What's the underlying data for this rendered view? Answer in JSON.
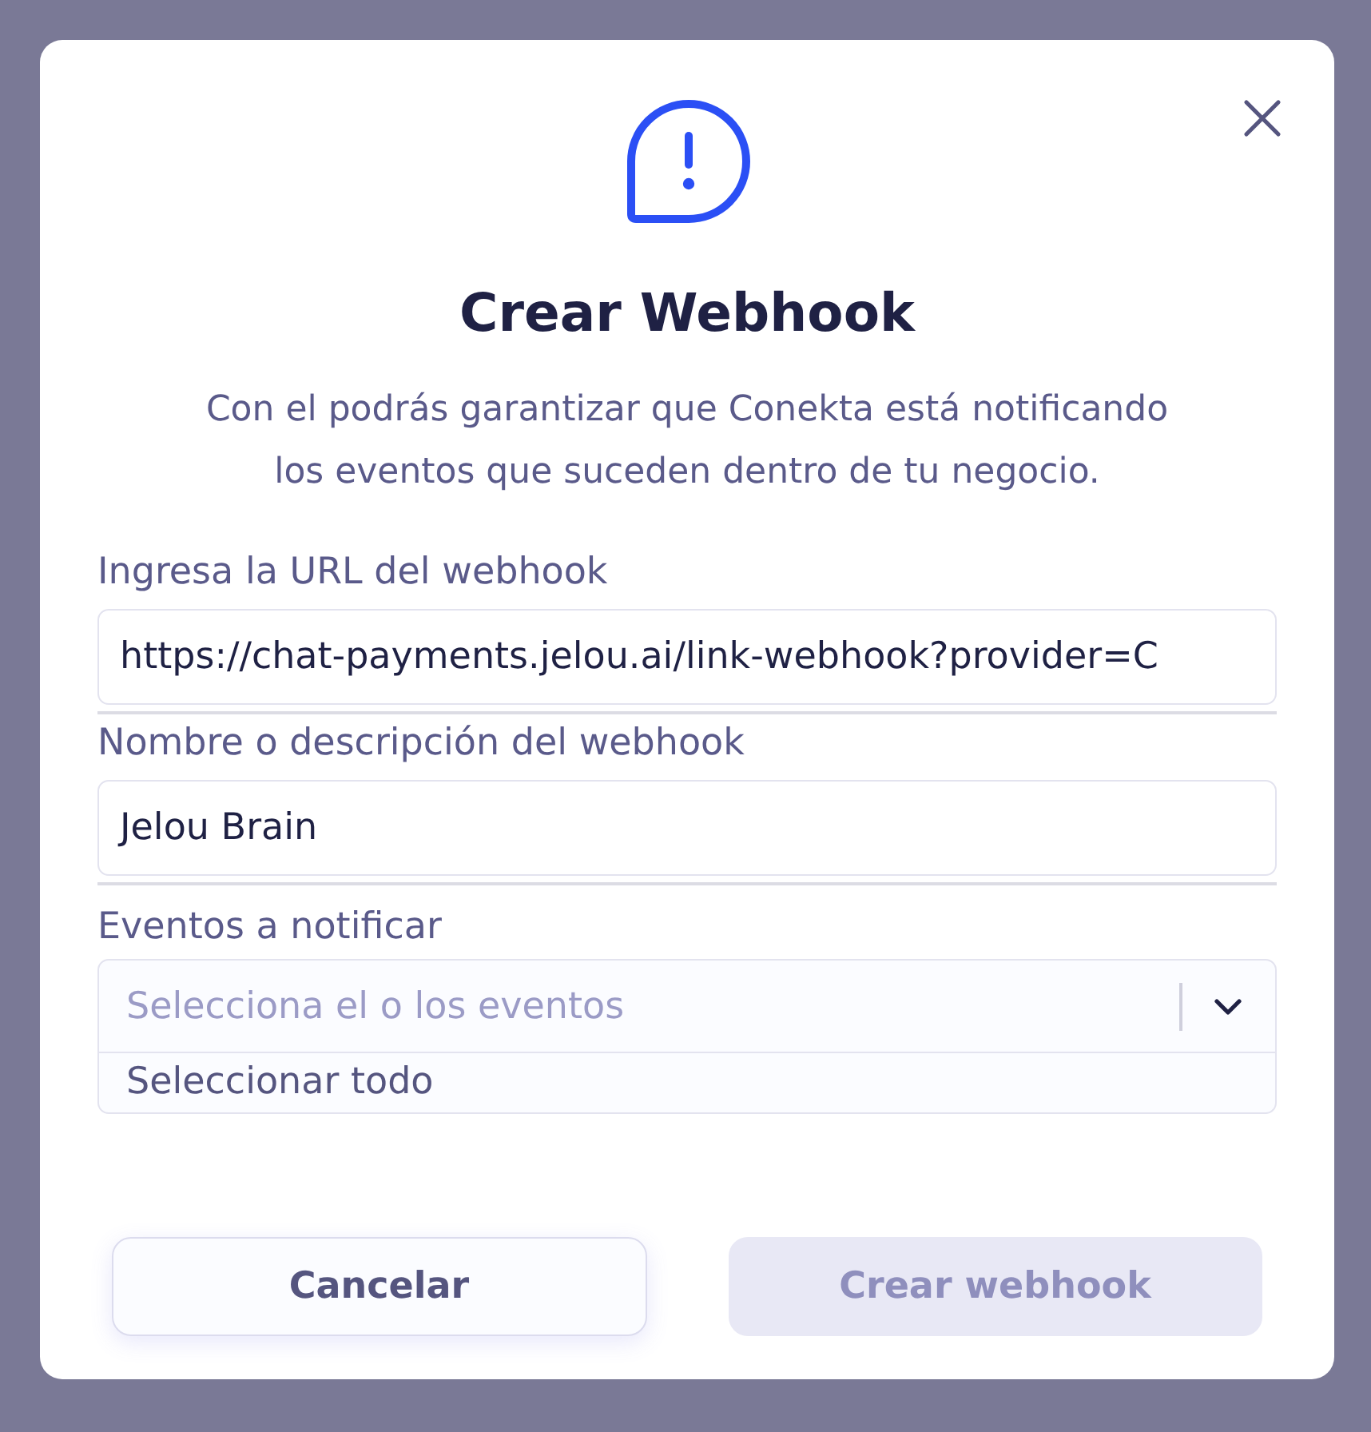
{
  "dialog": {
    "title": "Crear Webhook",
    "description": "Con el podrás garantizar que Conekta está notificando los eventos que suceden dentro de tu negocio."
  },
  "fields": [
    {
      "kind": "text",
      "label": "Ingresa la URL del webhook",
      "value": "https://chat-payments.jelou.ai/link-webhook?provider=C"
    },
    {
      "kind": "text",
      "label": "Nombre o descripción del webhook",
      "value": "Jelou Brain"
    },
    {
      "kind": "select",
      "label": "Eventos a notificar",
      "placeholder": "Selecciona el o los eventos",
      "expanded": true,
      "options": [
        {
          "label": "Seleccionar todo"
        }
      ]
    }
  ],
  "buttons": [
    {
      "kind": "secondary",
      "label": "Cancelar",
      "disabled": false
    },
    {
      "kind": "primary",
      "label": "Crear webhook",
      "disabled": true
    }
  ]
}
